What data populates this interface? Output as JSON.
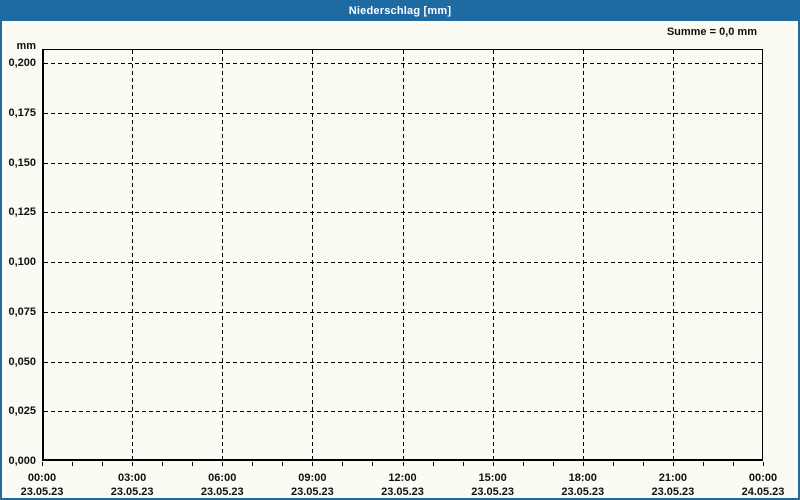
{
  "titlebar": {
    "title": "Niederschlag [mm]"
  },
  "summary": {
    "label": "Summe = 0,0 mm"
  },
  "chart_data": {
    "type": "line",
    "title": "Niederschlag [mm]",
    "ylabel": "mm",
    "ylim": [
      0,
      0.2
    ],
    "grid": "dashed",
    "legend_position": "none",
    "y_ticks": [
      {
        "label": "0,000",
        "value": 0.0
      },
      {
        "label": "0,025",
        "value": 0.025
      },
      {
        "label": "0,050",
        "value": 0.05
      },
      {
        "label": "0,075",
        "value": 0.075
      },
      {
        "label": "0,100",
        "value": 0.1
      },
      {
        "label": "0,125",
        "value": 0.125
      },
      {
        "label": "0,150",
        "value": 0.15
      },
      {
        "label": "0,175",
        "value": 0.175
      },
      {
        "label": "0,200",
        "value": 0.2
      }
    ],
    "x_ticks": [
      {
        "time": "00:00",
        "date": "23.05.23"
      },
      {
        "time": "03:00",
        "date": "23.05.23"
      },
      {
        "time": "06:00",
        "date": "23.05.23"
      },
      {
        "time": "09:00",
        "date": "23.05.23"
      },
      {
        "time": "12:00",
        "date": "23.05.23"
      },
      {
        "time": "15:00",
        "date": "23.05.23"
      },
      {
        "time": "18:00",
        "date": "23.05.23"
      },
      {
        "time": "21:00",
        "date": "23.05.23"
      },
      {
        "time": "00:00",
        "date": "24.05.23"
      }
    ],
    "x_minor_tick_count": 25,
    "series": [
      {
        "name": "Niederschlag",
        "values": [],
        "sum_mm": "0,0"
      }
    ]
  },
  "colors": {
    "accent_blue": "#1e6ba4",
    "background": "#fbfbf3",
    "grid": "#000000",
    "title_text": "#ffffff",
    "label_text": "#101010"
  }
}
